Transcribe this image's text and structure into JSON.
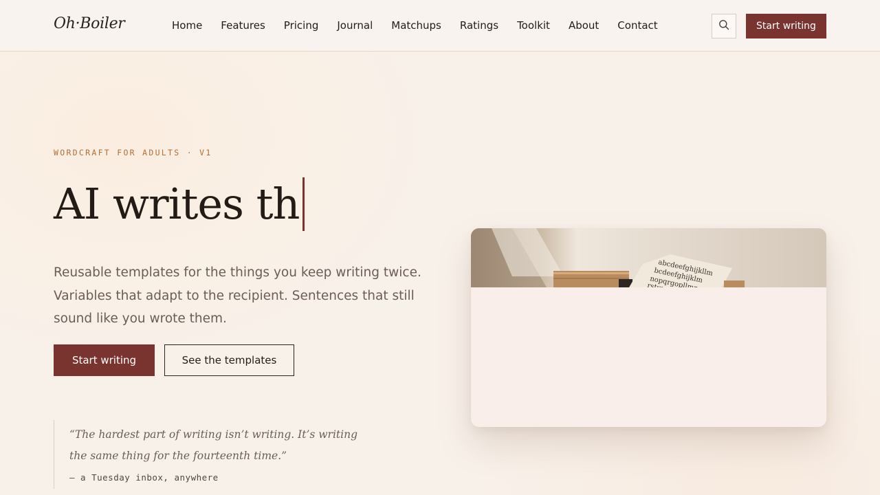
{
  "brand": {
    "name": "Oh·Boiler"
  },
  "nav": {
    "items": [
      "Home",
      "Features",
      "Pricing",
      "Journal",
      "Matchups",
      "Ratings",
      "Toolkit",
      "About",
      "Contact"
    ],
    "search_icon": "search-icon",
    "cta_label": "Start writing"
  },
  "hero": {
    "eyebrow": "WORDCRAFT FOR ADULTS · V1",
    "headline": "AI writes th",
    "subheading": "Reusable templates for the things you keep writing twice. Variables that adapt to the recipient. Sentences that still sound like you wrote them.",
    "primary_cta": "Start writing",
    "secondary_cta": "See the templates"
  },
  "quote": {
    "text": "“The hardest part of writing isn’t writing. It’s writing the same thing for the fourteenth time.”",
    "attribution": "— a Tuesday inbox, anywhere"
  },
  "preview_card": {
    "image_alt": "typewriter",
    "paper_lines": [
      "abcdeefghijkllm",
      "bcdeefghijklm",
      "nopqrgopllmn",
      "rstuv"
    ]
  },
  "colors": {
    "accent": "#7a3430",
    "eyebrow": "#b26f38",
    "text": "#231b16",
    "muted": "#6b5d55",
    "background": "#f8f1ea"
  }
}
